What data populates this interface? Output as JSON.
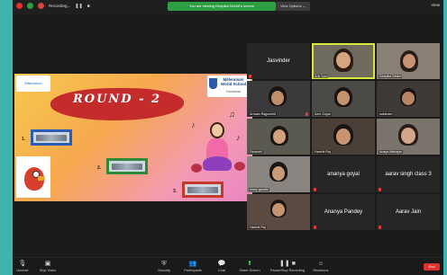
{
  "topbar": {
    "recording_label": "Recording...",
    "banner": "You are viewing Deepika Sekhri's screen",
    "view_options": "View Options ⌄",
    "view": "View"
  },
  "slide": {
    "title": "ROUND - 2",
    "logo_left": "Millennium",
    "logo_right_name": "Millennium World School",
    "logo_right_sub": "Faridabad",
    "questions": [
      "1.",
      "2.",
      "3."
    ]
  },
  "participants": [
    {
      "name": "Jasvinder",
      "video": false
    },
    {
      "name": "Kriti Soni",
      "video": true,
      "active": true
    },
    {
      "name": "Deepika Sekhri",
      "video": true
    },
    {
      "name": "Arnaan Rajpurohit",
      "video": true
    },
    {
      "name": "Azm Goyal",
      "video": true
    },
    {
      "name": "saksham",
      "video": true
    },
    {
      "name": "Divanshi",
      "video": true
    },
    {
      "name": "Harshit Raj",
      "video": true
    },
    {
      "name": "Anaya Mahajan",
      "video": true
    },
    {
      "name": "shrey gandhi",
      "video": true
    },
    {
      "name": "ananya goyal",
      "video": false
    },
    {
      "name": "aarav singh class 3",
      "video": false
    },
    {
      "name": "Harshit Raj",
      "video": true
    },
    {
      "name": "Ananya Pandey",
      "video": false
    },
    {
      "name": "Aarav Jain",
      "video": false
    }
  ],
  "toolbar": {
    "unmute": "Unmute",
    "stop_video": "Stop Video",
    "security": "Security",
    "participants": "Participants",
    "chat": "Chat",
    "share_screen": "Share Screen",
    "pause_recording": "Pause/Stop Recording",
    "reactions": "Reactions",
    "end": "End"
  },
  "colors": {
    "banner_green": "#2e9e43",
    "end_red": "#e0312d",
    "active_outline": "#d7e63a",
    "background_teal": "#3fb3b0"
  }
}
